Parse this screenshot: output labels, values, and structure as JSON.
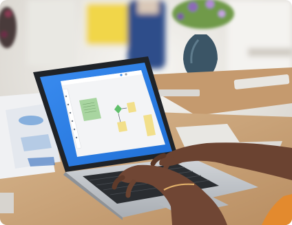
{
  "image": {
    "alt": "",
    "colors": {
      "wall": "#eceae6",
      "table_wood": "#c9a47a",
      "laptop_body": "#bfc3c8",
      "laptop_bezel": "#1f2328",
      "screen_blue": "#2a7de1",
      "canvas_bg": "#f3f4f6",
      "sticky_green": "#a8d5a0",
      "sticky_yellow": "#f2df8a",
      "skin": "#6b4331",
      "flowers_yellow": "#f4d44a",
      "shirt_blue": "#2f4e8a"
    }
  },
  "screen": {
    "sticky_1": "",
    "sticky_2": "",
    "sticky_3": "",
    "sticky_4": ""
  }
}
